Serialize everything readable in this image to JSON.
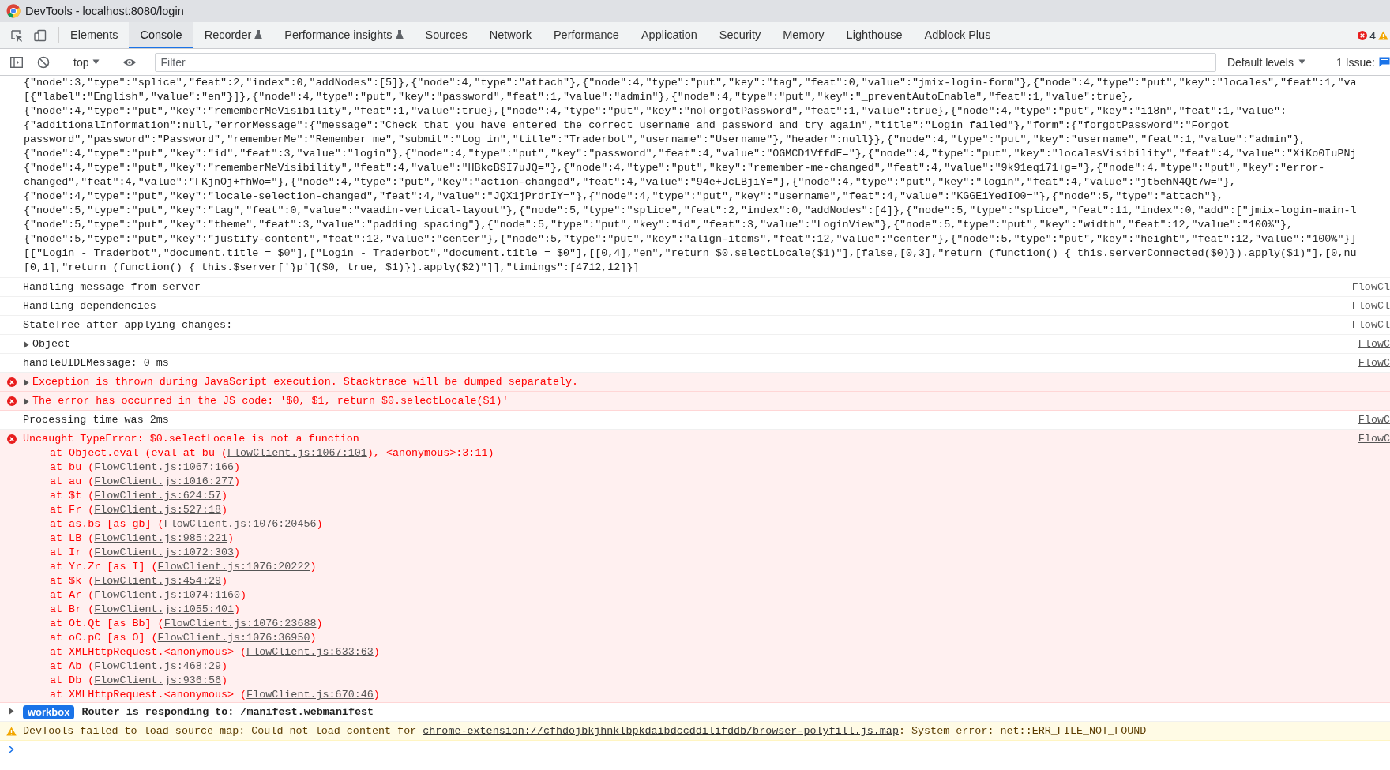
{
  "window": {
    "title": "DevTools - localhost:8080/login"
  },
  "panel_tabs": [
    {
      "label": "Elements",
      "selected": false,
      "experimental": false
    },
    {
      "label": "Console",
      "selected": true,
      "experimental": false
    },
    {
      "label": "Recorder",
      "selected": false,
      "experimental": true
    },
    {
      "label": "Performance insights",
      "selected": false,
      "experimental": true
    },
    {
      "label": "Sources",
      "selected": false,
      "experimental": false
    },
    {
      "label": "Network",
      "selected": false,
      "experimental": false
    },
    {
      "label": "Performance",
      "selected": false,
      "experimental": false
    },
    {
      "label": "Application",
      "selected": false,
      "experimental": false
    },
    {
      "label": "Security",
      "selected": false,
      "experimental": false
    },
    {
      "label": "Memory",
      "selected": false,
      "experimental": false
    },
    {
      "label": "Lighthouse",
      "selected": false,
      "experimental": false
    },
    {
      "label": "Adblock Plus",
      "selected": false,
      "experimental": false
    }
  ],
  "error_count": "4",
  "console_toolbar": {
    "context": "top",
    "filter": {
      "placeholder": "Filter"
    },
    "levels": "Default levels",
    "issues": "1 Issue:"
  },
  "messages": [
    {
      "kind": "dump",
      "lines": [
        "{\"node\":3,\"type\":\"splice\",\"feat\":2,\"index\":0,\"addNodes\":[5]},{\"node\":4,\"type\":\"attach\"},{\"node\":4,\"type\":\"put\",\"key\":\"tag\",\"feat\":0,\"value\":\"jmix-login-form\"},{\"node\":4,\"type\":\"put\",\"key\":\"locales\",\"feat\":1,\"va",
        "[{\"label\":\"English\",\"value\":\"en\"}]},{\"node\":4,\"type\":\"put\",\"key\":\"password\",\"feat\":1,\"value\":\"admin\"},{\"node\":4,\"type\":\"put\",\"key\":\"_preventAutoEnable\",\"feat\":1,\"value\":true},",
        "{\"node\":4,\"type\":\"put\",\"key\":\"rememberMeVisibility\",\"feat\":1,\"value\":true},{\"node\":4,\"type\":\"put\",\"key\":\"noForgotPassword\",\"feat\":1,\"value\":true},{\"node\":4,\"type\":\"put\",\"key\":\"i18n\",\"feat\":1,\"value\":",
        "{\"additionalInformation\":null,\"errorMessage\":{\"message\":\"Check that you have entered the correct username and password and try again\",\"title\":\"Login failed\"},\"form\":{\"forgotPassword\":\"Forgot",
        "password\",\"password\":\"Password\",\"rememberMe\":\"Remember me\",\"submit\":\"Log in\",\"title\":\"Traderbot\",\"username\":\"Username\"},\"header\":null}},{\"node\":4,\"type\":\"put\",\"key\":\"username\",\"feat\":1,\"value\":\"admin\"},",
        "{\"node\":4,\"type\":\"put\",\"key\":\"id\",\"feat\":3,\"value\":\"login\"},{\"node\":4,\"type\":\"put\",\"key\":\"password\",\"feat\":4,\"value\":\"OGMCD1VffdE=\"},{\"node\":4,\"type\":\"put\",\"key\":\"localesVisibility\",\"feat\":4,\"value\":\"XiKo0IuPNj",
        "{\"node\":4,\"type\":\"put\",\"key\":\"rememberMeVisibility\",\"feat\":4,\"value\":\"HBkcBSI7uJQ=\"},{\"node\":4,\"type\":\"put\",\"key\":\"remember-me-changed\",\"feat\":4,\"value\":\"9k91eq171+g=\"},{\"node\":4,\"type\":\"put\",\"key\":\"error-",
        "changed\",\"feat\":4,\"value\":\"FKjnOj+fhWo=\"},{\"node\":4,\"type\":\"put\",\"key\":\"action-changed\",\"feat\":4,\"value\":\"94e+JcLBjiY=\"},{\"node\":4,\"type\":\"put\",\"key\":\"login\",\"feat\":4,\"value\":\"jt5ehN4Qt7w=\"},",
        "{\"node\":4,\"type\":\"put\",\"key\":\"locale-selection-changed\",\"feat\":4,\"value\":\"JQX1jPrdrIY=\"},{\"node\":4,\"type\":\"put\",\"key\":\"username\",\"feat\":4,\"value\":\"KGGEiYedIO0=\"},{\"node\":5,\"type\":\"attach\"},",
        "{\"node\":5,\"type\":\"put\",\"key\":\"tag\",\"feat\":0,\"value\":\"vaadin-vertical-layout\"},{\"node\":5,\"type\":\"splice\",\"feat\":2,\"index\":0,\"addNodes\":[4]},{\"node\":5,\"type\":\"splice\",\"feat\":11,\"index\":0,\"add\":[\"jmix-login-main-l",
        "{\"node\":5,\"type\":\"put\",\"key\":\"theme\",\"feat\":3,\"value\":\"padding spacing\"},{\"node\":5,\"type\":\"put\",\"key\":\"id\",\"feat\":3,\"value\":\"LoginView\"},{\"node\":5,\"type\":\"put\",\"key\":\"width\",\"feat\":12,\"value\":\"100%\"},",
        "{\"node\":5,\"type\":\"put\",\"key\":\"justify-content\",\"feat\":12,\"value\":\"center\"},{\"node\":5,\"type\":\"put\",\"key\":\"align-items\",\"feat\":12,\"value\":\"center\"},{\"node\":5,\"type\":\"put\",\"key\":\"height\",\"feat\":12,\"value\":\"100%\"}]",
        "[[\"Login - Traderbot\",\"document.title = $0\"],[\"Login - Traderbot\",\"document.title = $0\"],[[0,4],\"en\",\"return $0.selectLocale($1)\"],[false,[0,3],\"return (function() { this.serverConnected($0)}).apply($1)\"],[0,nu",
        "[0,1],\"return (function() { this.$server['}p']($0, true, $1)}).apply($2)\"]],\"timings\":[4712,12]}]"
      ]
    },
    {
      "kind": "log",
      "text": "Handling message from server",
      "source": "FlowCl"
    },
    {
      "kind": "log",
      "text": "Handling dependencies",
      "source": "FlowCl"
    },
    {
      "kind": "log",
      "text": "StateTree after applying changes:",
      "source": "FlowCl"
    },
    {
      "kind": "object",
      "text": "Object",
      "expanded": false,
      "source": "FlowC"
    },
    {
      "kind": "log",
      "text": "handleUIDLMessage: 0 ms",
      "source": "FlowC"
    },
    {
      "kind": "error",
      "text": "Exception is thrown during JavaScript execution. Stacktrace will be dumped separately.",
      "expanded": false
    },
    {
      "kind": "error",
      "text": "The error has occurred in the JS code: '$0, $1, return $0.selectLocale($1)'",
      "expanded": false
    },
    {
      "kind": "log",
      "text": "Processing time was 2ms",
      "source": "FlowC"
    },
    {
      "kind": "error",
      "text": "Uncaught TypeError: $0.selectLocale is not a function",
      "source": "FlowC",
      "stack": [
        {
          "before": "at Object.eval (eval at bu (",
          "link": "FlowClient.js:1067:101",
          "after": "), <anonymous>:3:11)"
        },
        {
          "before": "at bu (",
          "link": "FlowClient.js:1067:166",
          "after": ")"
        },
        {
          "before": "at au (",
          "link": "FlowClient.js:1016:277",
          "after": ")"
        },
        {
          "before": "at $t (",
          "link": "FlowClient.js:624:57",
          "after": ")"
        },
        {
          "before": "at Fr (",
          "link": "FlowClient.js:527:18",
          "after": ")"
        },
        {
          "before": "at as.bs [as gb] (",
          "link": "FlowClient.js:1076:20456",
          "after": ")"
        },
        {
          "before": "at LB (",
          "link": "FlowClient.js:985:221",
          "after": ")"
        },
        {
          "before": "at Ir (",
          "link": "FlowClient.js:1072:303",
          "after": ")"
        },
        {
          "before": "at Yr.Zr [as I] (",
          "link": "FlowClient.js:1076:20222",
          "after": ")"
        },
        {
          "before": "at $k (",
          "link": "FlowClient.js:454:29",
          "after": ")"
        },
        {
          "before": "at Ar (",
          "link": "FlowClient.js:1074:1160",
          "after": ")"
        },
        {
          "before": "at Br (",
          "link": "FlowClient.js:1055:401",
          "after": ")"
        },
        {
          "before": "at Ot.Qt [as Bb] (",
          "link": "FlowClient.js:1076:23688",
          "after": ")"
        },
        {
          "before": "at oC.pC [as O] (",
          "link": "FlowClient.js:1076:36950",
          "after": ")"
        },
        {
          "before": "at XMLHttpRequest.<anonymous> (",
          "link": "FlowClient.js:633:63",
          "after": ")"
        },
        {
          "before": "at Ab (",
          "link": "FlowClient.js:468:29",
          "after": ")"
        },
        {
          "before": "at Db (",
          "link": "FlowClient.js:936:56",
          "after": ")"
        },
        {
          "before": "at XMLHttpRequest.<anonymous> (",
          "link": "FlowClient.js:670:46",
          "after": ")"
        }
      ]
    },
    {
      "kind": "workbox",
      "badge": "workbox",
      "text": "Router is responding to: /manifest.webmanifest",
      "expanded": false
    },
    {
      "kind": "warning",
      "text": "DevTools failed to load source map: Could not load content for ",
      "link": "chrome-extension://cfhdojbkjhnklbpkdaibdccddilifddb/browser-polyfill.js.map",
      "after": ": System error: net::ERR_FILE_NOT_FOUND"
    },
    {
      "kind": "prompt"
    }
  ]
}
